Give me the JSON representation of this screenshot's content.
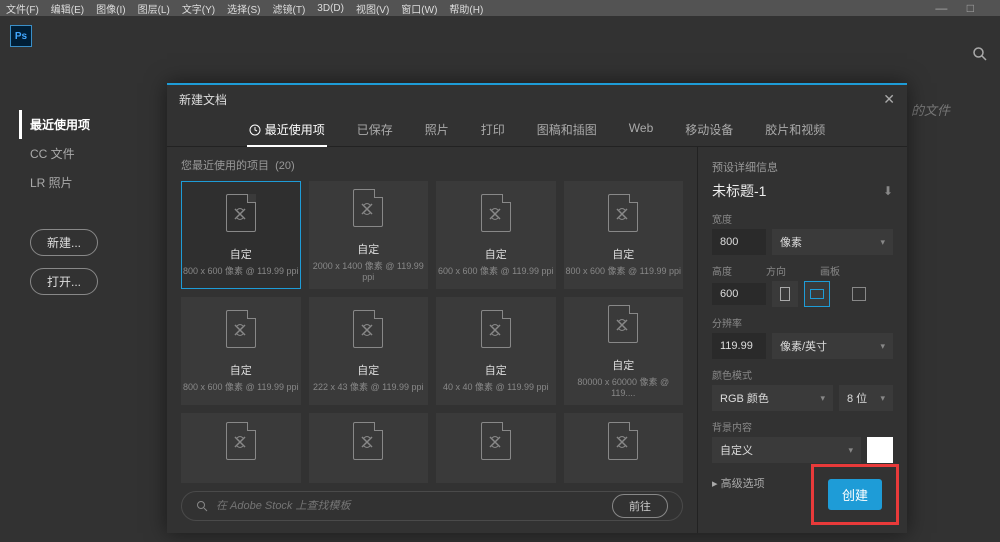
{
  "menu": {
    "items": [
      "文件(F)",
      "编辑(E)",
      "图像(I)",
      "图层(L)",
      "文字(Y)",
      "选择(S)",
      "滤镜(T)",
      "3D(D)",
      "视图(V)",
      "窗口(W)",
      "帮助(H)"
    ],
    "winctrl": "— □"
  },
  "sidebar": {
    "items": [
      {
        "label": "最近使用项",
        "active": true
      },
      {
        "label": "CC 文件"
      },
      {
        "label": "LR 照片"
      }
    ],
    "new_btn": "新建...",
    "open_btn": "打开..."
  },
  "yourfiles": "的文件",
  "dialog": {
    "title": "新建文档",
    "tabs": [
      "最近使用项",
      "已保存",
      "照片",
      "打印",
      "图稿和插图",
      "Web",
      "移动设备",
      "胶片和视频"
    ],
    "recent_label": "您最近使用的项目",
    "recent_count": "(20)",
    "presets": [
      {
        "name": "自定",
        "sub": "800 x 600 像素 @ 119.99 ppi",
        "sel": true
      },
      {
        "name": "自定",
        "sub": "2000 x 1400 像素 @ 119.99 ppi"
      },
      {
        "name": "自定",
        "sub": "600 x 600 像素 @ 119.99 ppi"
      },
      {
        "name": "自定",
        "sub": "800 x 600 像素 @ 119.99 ppi"
      },
      {
        "name": "自定",
        "sub": "800 x 600 像素 @ 119.99 ppi"
      },
      {
        "name": "自定",
        "sub": "222 x 43 像素 @ 119.99 ppi"
      },
      {
        "name": "自定",
        "sub": "40 x 40 像素 @ 119.99 ppi"
      },
      {
        "name": "自定",
        "sub": "80000 x 60000 像素 @ 119...."
      },
      {
        "name": "",
        "sub": ""
      },
      {
        "name": "",
        "sub": ""
      },
      {
        "name": "",
        "sub": ""
      },
      {
        "name": "",
        "sub": ""
      }
    ],
    "stock_placeholder": "在 Adobe Stock 上查找模板",
    "go": "前往",
    "details": {
      "head": "预设详细信息",
      "title": "未标题-1",
      "width_lbl": "宽度",
      "width": "800",
      "unit": "像素",
      "height_lbl": "高度",
      "orient_lbl": "方向",
      "artboard_lbl": "画板",
      "height": "600",
      "res_lbl": "分辨率",
      "res": "119.99",
      "res_unit": "像素/英寸",
      "color_lbl": "颜色模式",
      "color": "RGB 颜色",
      "depth": "8 位",
      "bg_lbl": "背景内容",
      "bg": "自定义",
      "adv": "高级选项",
      "create": "创建"
    }
  }
}
